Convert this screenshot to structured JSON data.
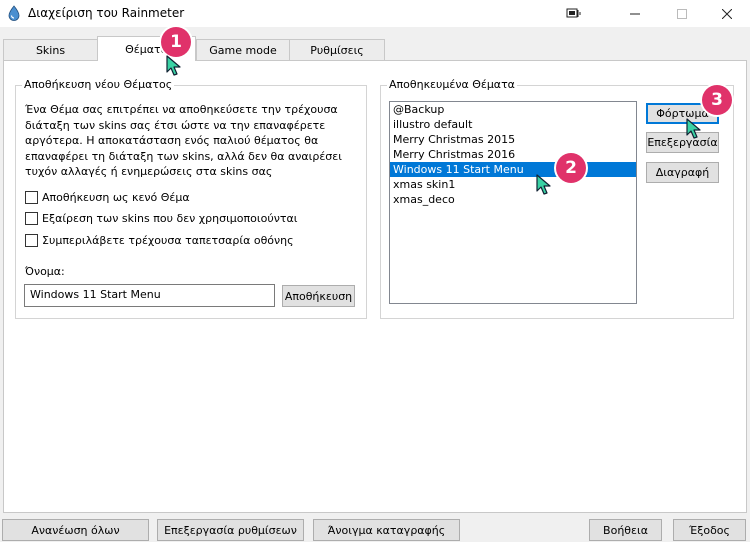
{
  "window": {
    "title": "Διαχείριση του Rainmeter",
    "icon": "rainmeter-drop-icon"
  },
  "tabs": [
    {
      "label": "Skins"
    },
    {
      "label": "Θέματα"
    },
    {
      "label": "Game mode"
    },
    {
      "label": "Ρυθμίσεις"
    }
  ],
  "save_theme": {
    "title": "Αποθήκευση νέου Θέματος",
    "description": "Ένα Θέμα σας επιτρέπει να αποθηκεύσετε την τρέχουσα διάταξη των skins σας έτσι ώστε να την επαναφέρετε αργότερα. Η αποκατάσταση ενός παλιού θέματος θα επαναφέρει τη διάταξη των skins, αλλά δεν θα αναιρέσει τυχόν αλλαγές ή ενημερώσεις στα skins σας",
    "options": [
      {
        "label": "Αποθήκευση ως κενό Θέμα",
        "checked": false
      },
      {
        "label": "Εξαίρεση των skins που δεν χρησιμοποιούνται",
        "checked": false
      },
      {
        "label": "Συμπεριλάβετε τρέχουσα ταπετσαρία οθόνης",
        "checked": false
      }
    ],
    "name_label": "Όνομα:",
    "name_value": "Windows 11 Start Menu",
    "save_button": "Αποθήκευση"
  },
  "saved_themes": {
    "title": "Αποθηκευμένα Θέματα",
    "items": [
      {
        "label": "@Backup",
        "selected": false
      },
      {
        "label": "illustro default",
        "selected": false
      },
      {
        "label": "Merry Christmas 2015",
        "selected": false
      },
      {
        "label": "Merry Christmas 2016",
        "selected": false
      },
      {
        "label": "Windows 11 Start Menu",
        "selected": true
      },
      {
        "label": "xmas skin1",
        "selected": false
      },
      {
        "label": "xmas_deco",
        "selected": false
      }
    ],
    "load_button": "Φόρτωμα",
    "edit_button": "Επεξεργασία",
    "delete_button": "Διαγραφή"
  },
  "bottom": {
    "refresh_all": "Ανανέωση όλων",
    "edit_settings": "Επεξεργασία ρυθμίσεων",
    "open_log": "Άνοιγμα καταγραφής",
    "help": "Βοήθεια",
    "exit": "Έξοδος"
  },
  "annotations": {
    "step1": "1",
    "step2": "2",
    "step3": "3",
    "badge_color": "#e0326a"
  }
}
